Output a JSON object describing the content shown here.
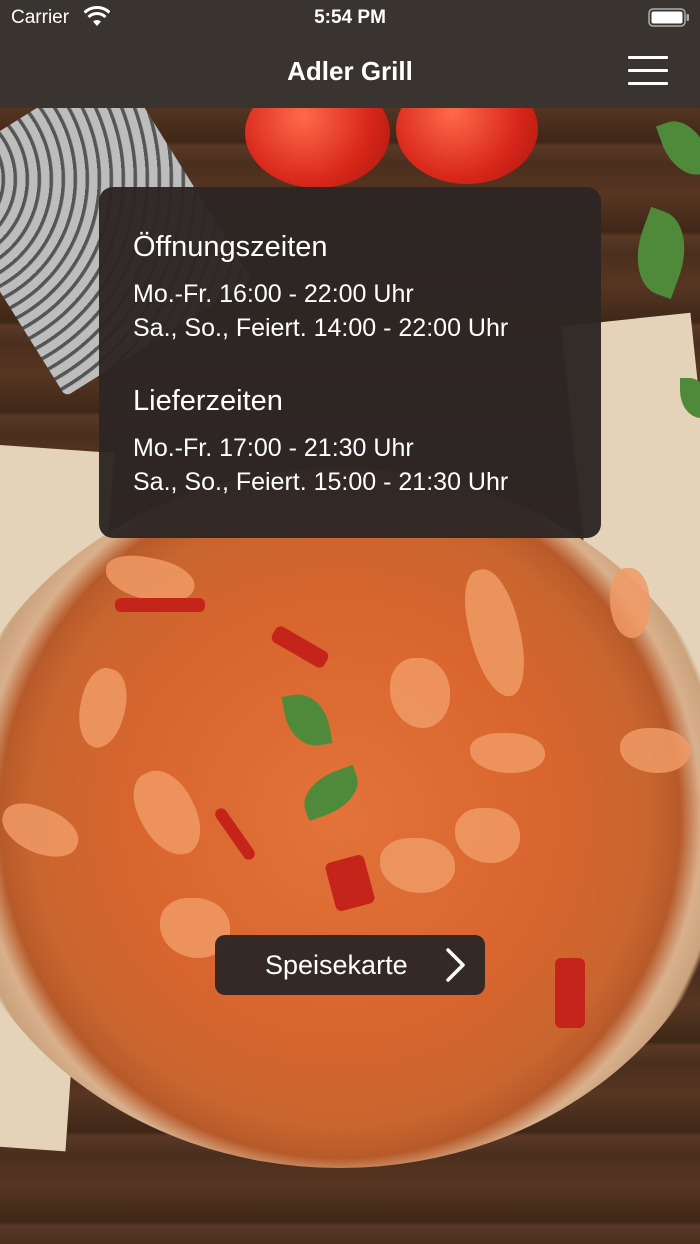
{
  "status_bar": {
    "carrier": "Carrier",
    "time": "5:54 PM"
  },
  "nav": {
    "title": "Adler Grill",
    "menu_icon": "hamburger-menu-icon"
  },
  "hours_card": {
    "opening": {
      "heading": "Öffnungszeiten",
      "lines": [
        "Mo.-Fr. 16:00 - 22:00 Uhr",
        "Sa., So., Feiert. 14:00 - 22:00 Uhr"
      ]
    },
    "delivery": {
      "heading": "Lieferzeiten",
      "lines": [
        "Mo.-Fr. 17:00 - 21:30 Uhr",
        "Sa., So., Feiert. 15:00 - 21:30 Uhr"
      ]
    }
  },
  "menu_button": {
    "label": "Speisekarte",
    "icon": "chevron-right-icon"
  },
  "colors": {
    "bar": "#3a3431",
    "card": "#2d2624"
  }
}
